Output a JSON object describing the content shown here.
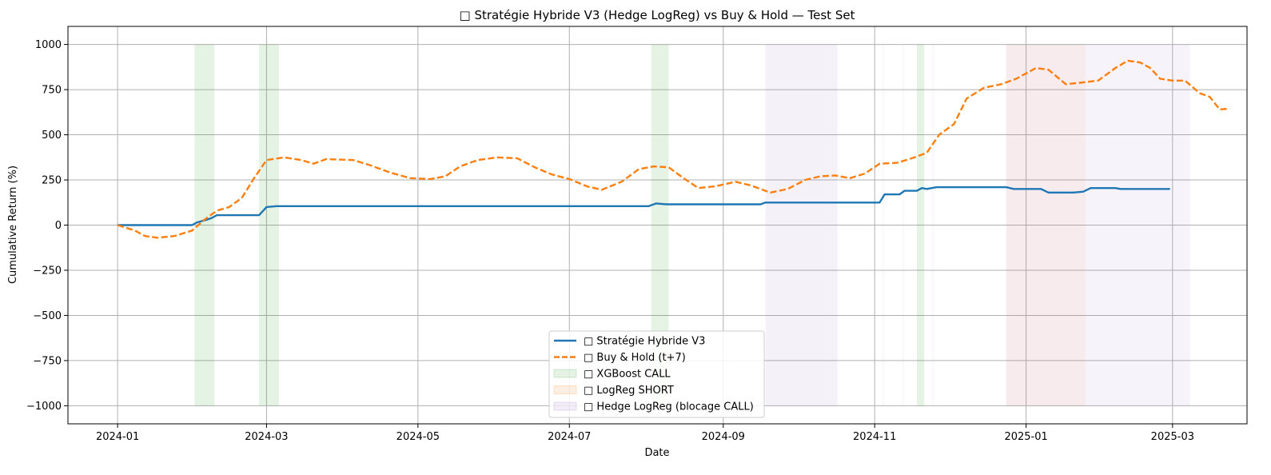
{
  "chart_data": {
    "type": "line",
    "title": "□ Stratégie Hybride V3 (Hedge LogReg) vs Buy & Hold — Test Set",
    "xlabel": "Date",
    "ylabel": "Cumulative Return (%)",
    "x_ticks": [
      "2024-01",
      "2024-03",
      "2024-05",
      "2024-07",
      "2024-09",
      "2024-11",
      "2025-01",
      "2025-03"
    ],
    "y_ticks": [
      1000,
      750,
      500,
      250,
      0,
      -250,
      -500,
      -750,
      -1000
    ],
    "y_tick_labels": [
      "1000",
      "750",
      "500",
      "250",
      "0",
      "−250",
      "−500",
      "−750",
      "−1000"
    ],
    "xlim": [
      "2023-12-12",
      "2025-03-31"
    ],
    "ylim": [
      -1100,
      1100
    ],
    "grid": true,
    "legend_position": "lower center",
    "series": [
      {
        "name": "□ Stratégie Hybride V3",
        "color": "#1f77b4",
        "style": "solid",
        "points": [
          [
            "2024-01-01",
            0
          ],
          [
            "2024-01-31",
            0
          ],
          [
            "2024-02-02",
            15
          ],
          [
            "2024-02-06",
            30
          ],
          [
            "2024-02-08",
            40
          ],
          [
            "2024-02-10",
            55
          ],
          [
            "2024-02-27",
            55
          ],
          [
            "2024-03-01",
            100
          ],
          [
            "2024-03-05",
            105
          ],
          [
            "2024-08-02",
            105
          ],
          [
            "2024-08-05",
            120
          ],
          [
            "2024-08-09",
            115
          ],
          [
            "2024-09-16",
            115
          ],
          [
            "2024-09-18",
            125
          ],
          [
            "2024-11-03",
            125
          ],
          [
            "2024-11-05",
            170
          ],
          [
            "2024-11-11",
            170
          ],
          [
            "2024-11-13",
            190
          ],
          [
            "2024-11-18",
            190
          ],
          [
            "2024-11-20",
            205
          ],
          [
            "2024-11-22",
            200
          ],
          [
            "2024-11-26",
            210
          ],
          [
            "2024-12-24",
            210
          ],
          [
            "2024-12-27",
            200
          ],
          [
            "2025-01-07",
            200
          ],
          [
            "2025-01-10",
            180
          ],
          [
            "2025-01-20",
            180
          ],
          [
            "2025-01-24",
            185
          ],
          [
            "2025-01-27",
            205
          ],
          [
            "2025-02-06",
            205
          ],
          [
            "2025-02-08",
            200
          ],
          [
            "2025-02-28",
            200
          ]
        ]
      },
      {
        "name": "□ Buy & Hold (t+7)",
        "color": "#ff7f0e",
        "style": "dashed",
        "points": [
          [
            "2024-01-01",
            0
          ],
          [
            "2024-01-08",
            -30
          ],
          [
            "2024-01-12",
            -60
          ],
          [
            "2024-01-17",
            -70
          ],
          [
            "2024-01-24",
            -60
          ],
          [
            "2024-01-31",
            -30
          ],
          [
            "2024-02-05",
            30
          ],
          [
            "2024-02-10",
            80
          ],
          [
            "2024-02-15",
            100
          ],
          [
            "2024-02-20",
            150
          ],
          [
            "2024-02-25",
            260
          ],
          [
            "2024-03-01",
            360
          ],
          [
            "2024-03-08",
            375
          ],
          [
            "2024-03-15",
            360
          ],
          [
            "2024-03-20",
            340
          ],
          [
            "2024-03-25",
            365
          ],
          [
            "2024-04-05",
            360
          ],
          [
            "2024-04-12",
            330
          ],
          [
            "2024-04-20",
            290
          ],
          [
            "2024-04-28",
            260
          ],
          [
            "2024-05-06",
            255
          ],
          [
            "2024-05-12",
            270
          ],
          [
            "2024-05-18",
            325
          ],
          [
            "2024-05-25",
            360
          ],
          [
            "2024-06-02",
            375
          ],
          [
            "2024-06-10",
            370
          ],
          [
            "2024-06-17",
            320
          ],
          [
            "2024-06-24",
            280
          ],
          [
            "2024-07-01",
            255
          ],
          [
            "2024-07-08",
            215
          ],
          [
            "2024-07-14",
            195
          ],
          [
            "2024-07-22",
            240
          ],
          [
            "2024-07-29",
            310
          ],
          [
            "2024-08-04",
            325
          ],
          [
            "2024-08-10",
            320
          ],
          [
            "2024-08-16",
            260
          ],
          [
            "2024-08-22",
            205
          ],
          [
            "2024-08-29",
            215
          ],
          [
            "2024-09-06",
            240
          ],
          [
            "2024-09-12",
            220
          ],
          [
            "2024-09-20",
            180
          ],
          [
            "2024-09-27",
            200
          ],
          [
            "2024-10-04",
            250
          ],
          [
            "2024-10-10",
            270
          ],
          [
            "2024-10-16",
            275
          ],
          [
            "2024-10-22",
            260
          ],
          [
            "2024-10-28",
            285
          ],
          [
            "2024-11-03",
            340
          ],
          [
            "2024-11-10",
            345
          ],
          [
            "2024-11-16",
            370
          ],
          [
            "2024-11-22",
            400
          ],
          [
            "2024-11-27",
            500
          ],
          [
            "2024-12-03",
            560
          ],
          [
            "2024-12-08",
            700
          ],
          [
            "2024-12-15",
            760
          ],
          [
            "2024-12-22",
            780
          ],
          [
            "2024-12-28",
            810
          ],
          [
            "2025-01-05",
            870
          ],
          [
            "2025-01-10",
            860
          ],
          [
            "2025-01-17",
            780
          ],
          [
            "2025-01-24",
            790
          ],
          [
            "2025-01-30",
            800
          ],
          [
            "2025-02-06",
            870
          ],
          [
            "2025-02-11",
            910
          ],
          [
            "2025-02-16",
            900
          ],
          [
            "2025-02-20",
            870
          ],
          [
            "2025-02-24",
            810
          ],
          [
            "2025-03-01",
            800
          ],
          [
            "2025-03-06",
            800
          ],
          [
            "2025-03-12",
            730
          ],
          [
            "2025-03-16",
            710
          ],
          [
            "2025-03-20",
            640
          ],
          [
            "2025-03-24",
            645
          ]
        ]
      }
    ],
    "shaded_regions": [
      {
        "series": "□ XGBoost CALL",
        "start": "2024-02-01",
        "end": "2024-02-09",
        "color": "#2ca02c",
        "opacity": 0.12
      },
      {
        "series": "□ XGBoost CALL",
        "start": "2024-02-27",
        "end": "2024-03-06",
        "color": "#2ca02c",
        "opacity": 0.12
      },
      {
        "series": "□ XGBoost CALL",
        "start": "2024-08-03",
        "end": "2024-08-10",
        "color": "#2ca02c",
        "opacity": 0.12
      },
      {
        "series": "□ XGBoost CALL",
        "start": "2024-11-18",
        "end": "2024-11-21",
        "color": "#2ca02c",
        "opacity": 0.12
      },
      {
        "series": "□ LogReg SHORT",
        "start": "2024-12-24",
        "end": "2025-01-25",
        "color": "#ff7f0e",
        "opacity": 0.06
      },
      {
        "series": "□ Hedge LogReg (blocage CALL)",
        "start": "2024-09-18",
        "end": "2024-10-17",
        "color": "#9467bd",
        "opacity": 0.09
      },
      {
        "series": "□ Hedge LogReg (blocage CALL)",
        "start": "2024-11-04",
        "end": "2024-11-05",
        "color": "#9467bd",
        "opacity": 0.04
      },
      {
        "series": "□ Hedge LogReg (blocage CALL)",
        "start": "2024-11-12",
        "end": "2024-11-13",
        "color": "#9467bd",
        "opacity": 0.04
      },
      {
        "series": "□ Hedge LogReg (blocage CALL)",
        "start": "2024-11-24",
        "end": "2024-11-25",
        "color": "#9467bd",
        "opacity": 0.04
      },
      {
        "series": "□ Hedge LogReg (blocage CALL)",
        "start": "2024-12-24",
        "end": "2025-03-08",
        "color": "#9467bd",
        "opacity": 0.08
      }
    ],
    "legend": [
      {
        "label": "□ Stratégie Hybride V3",
        "kind": "line",
        "color": "#1f77b4"
      },
      {
        "label": "□ Buy & Hold (t+7)",
        "kind": "dashed",
        "color": "#ff7f0e"
      },
      {
        "label": "□ XGBoost CALL",
        "kind": "patch",
        "color": "#2ca02c"
      },
      {
        "label": "□ LogReg SHORT",
        "kind": "patch",
        "color": "#ff7f0e"
      },
      {
        "label": "□ Hedge LogReg (blocage CALL)",
        "kind": "patch",
        "color": "#9467bd"
      }
    ]
  }
}
